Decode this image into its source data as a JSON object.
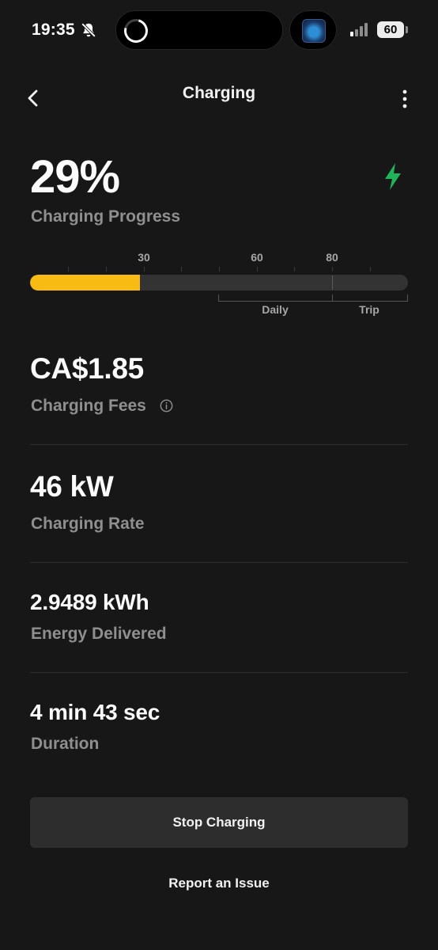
{
  "status_bar": {
    "time": "19:35",
    "battery": "60",
    "icons": [
      "bell-slash-icon",
      "activity-ring-icon",
      "app-thumbnail",
      "cellular-signal-icon",
      "battery-icon"
    ]
  },
  "header": {
    "title": "Charging",
    "back_icon": "chevron-left-icon",
    "menu_icon": "more-vertical-icon"
  },
  "progress": {
    "percent_text": "29%",
    "label": "Charging Progress",
    "fill_fraction": 0.29,
    "status_icon": "lightning-bolt-icon",
    "ticks": [
      "30",
      "60",
      "80"
    ],
    "ranges": [
      "Daily",
      "Trip"
    ]
  },
  "fees": {
    "value": "CA$1.85",
    "label": "Charging Fees",
    "info_icon": "info-icon"
  },
  "rate": {
    "value": "46 kW",
    "label": "Charging Rate"
  },
  "energy": {
    "value": "2.9489 kWh",
    "label": "Energy Delivered"
  },
  "duration": {
    "value": "4 min 43 sec",
    "label": "Duration"
  },
  "actions": {
    "stop_label": "Stop Charging",
    "report_label": "Report an Issue"
  },
  "colors": {
    "background": "#171717",
    "progress_fill": "#f7bb13",
    "progress_track": "#333333",
    "bolt": "#21b35a",
    "label_gray": "#8f8f8f",
    "button_bg": "#2d2d2d"
  }
}
